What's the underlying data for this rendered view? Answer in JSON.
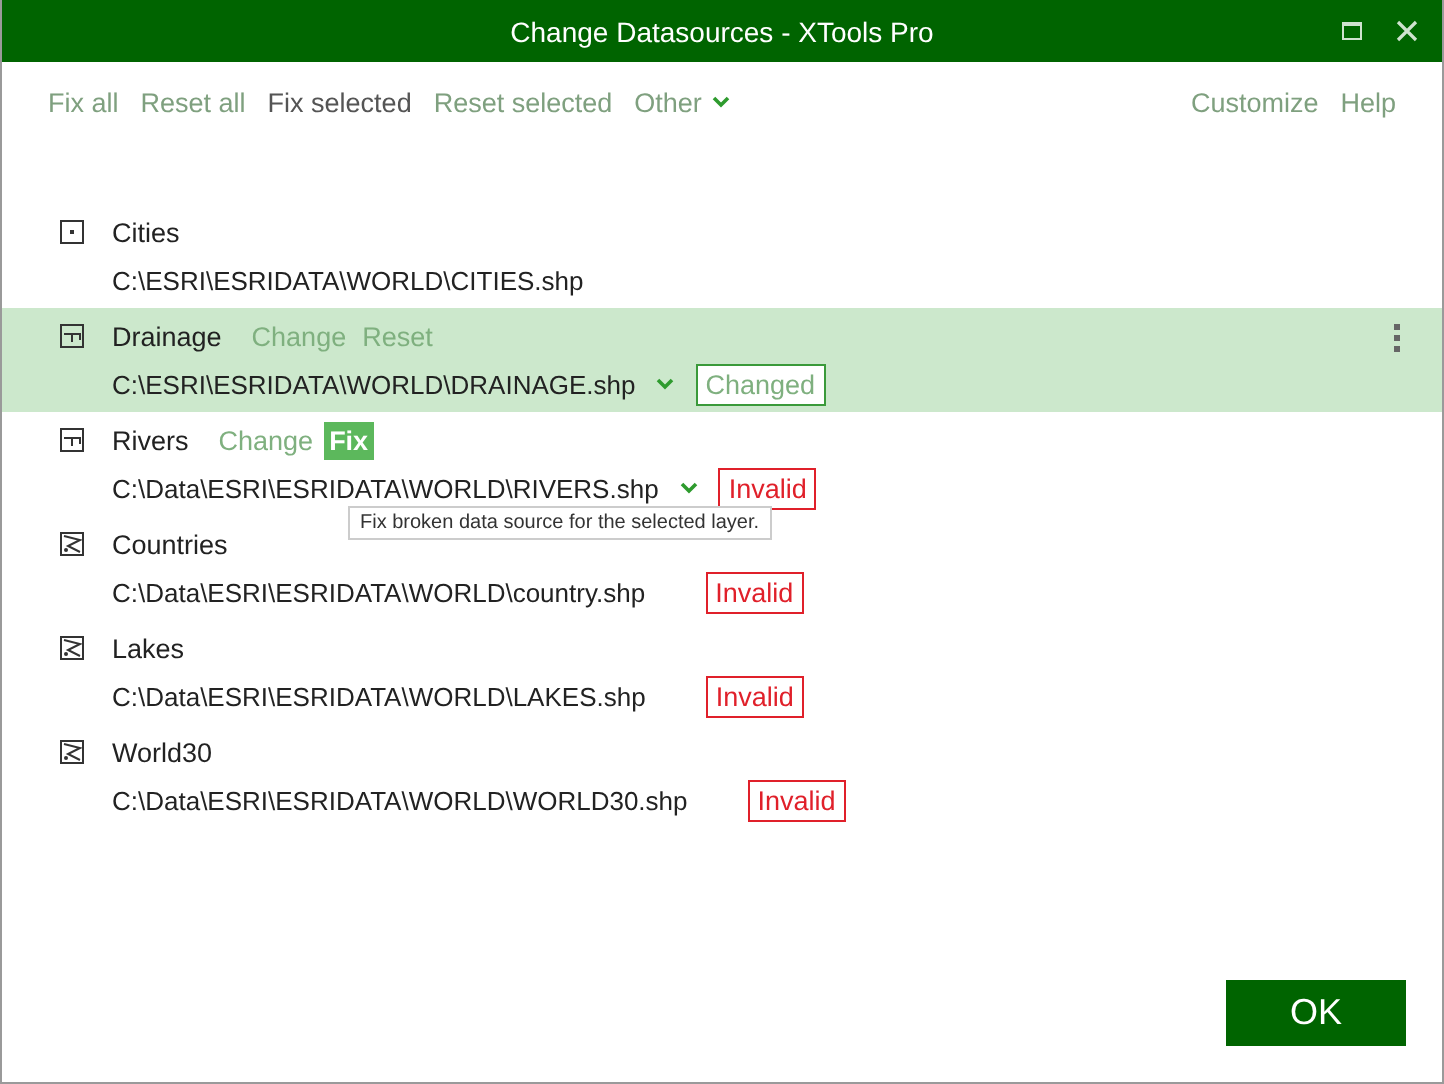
{
  "window": {
    "title": "Change Datasources - XTools Pro"
  },
  "toolbar": {
    "left": [
      {
        "label": "Fix all",
        "emphasized": false,
        "has_menu": false
      },
      {
        "label": "Reset all",
        "emphasized": false,
        "has_menu": false
      },
      {
        "label": "Fix selected",
        "emphasized": true,
        "has_menu": false
      },
      {
        "label": "Reset selected",
        "emphasized": false,
        "has_menu": false
      },
      {
        "label": "Other",
        "emphasized": false,
        "has_menu": true
      }
    ],
    "right": [
      {
        "label": "Customize"
      },
      {
        "label": "Help"
      }
    ]
  },
  "layers": [
    {
      "name": "Cities",
      "kind": "point",
      "path": "C:\\ESRI\\ESRIDATA\\WORLD\\CITIES.shp",
      "selected": false,
      "path_menu": false
    },
    {
      "name": "Drainage",
      "kind": "line",
      "path": "C:\\ESRI\\ESRIDATA\\WORLD\\DRAINAGE.shp",
      "selected": true,
      "path_menu": true,
      "actions": [
        {
          "label": "Change",
          "hovered": false
        },
        {
          "label": "Reset",
          "hovered": false
        }
      ],
      "status": {
        "kind": "changed",
        "label": "Changed"
      }
    },
    {
      "name": "Rivers",
      "kind": "line",
      "path": "C:\\Data\\ESRI\\ESRIDATA\\WORLD\\RIVERS.shp",
      "selected": false,
      "path_menu": true,
      "actions": [
        {
          "label": "Change",
          "hovered": false
        },
        {
          "label": "Fix",
          "hovered": true
        }
      ],
      "status": {
        "kind": "invalid",
        "label": "Invalid"
      },
      "tooltip": "Fix broken data source for the selected layer."
    },
    {
      "name": "Countries",
      "kind": "polygon",
      "path": "C:\\Data\\ESRI\\ESRIDATA\\WORLD\\country.shp",
      "selected": false,
      "path_menu": false,
      "status": {
        "kind": "invalid",
        "label": "Invalid"
      }
    },
    {
      "name": "Lakes",
      "kind": "polygon",
      "path": "C:\\Data\\ESRI\\ESRIDATA\\WORLD\\LAKES.shp",
      "selected": false,
      "path_menu": false,
      "status": {
        "kind": "invalid",
        "label": "Invalid"
      }
    },
    {
      "name": "World30",
      "kind": "polygon",
      "path": "C:\\Data\\ESRI\\ESRIDATA\\WORLD\\WORLD30.shp",
      "selected": false,
      "path_menu": false,
      "status": {
        "kind": "invalid",
        "label": "Invalid"
      }
    }
  ],
  "ok_button": "OK"
}
